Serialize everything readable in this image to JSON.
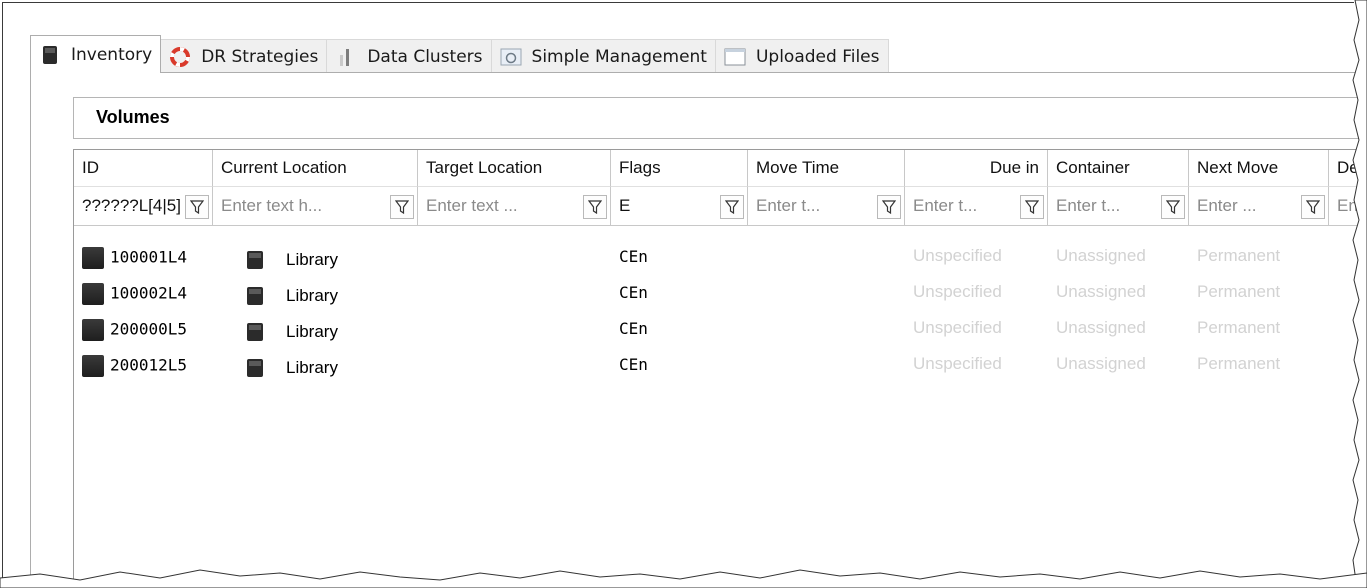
{
  "tabs": [
    {
      "label": "Inventory",
      "icon": "tape-library-icon",
      "active": true
    },
    {
      "label": "DR Strategies",
      "icon": "lifebuoy-icon",
      "active": false
    },
    {
      "label": "Data Clusters",
      "icon": "data-cluster-icon",
      "active": false
    },
    {
      "label": "Simple Management",
      "icon": "simple-management-icon",
      "active": false
    },
    {
      "label": "Uploaded Files",
      "icon": "uploaded-files-icon",
      "active": false
    }
  ],
  "group": {
    "title": "Volumes"
  },
  "columns": [
    {
      "header": "ID",
      "filter_value": "??????L[4|5]",
      "filter_placeholder": ""
    },
    {
      "header": "Current Location",
      "filter_value": "",
      "filter_placeholder": "Enter text h..."
    },
    {
      "header": "Target Location",
      "filter_value": "",
      "filter_placeholder": "Enter text ..."
    },
    {
      "header": "Flags",
      "filter_value": "E",
      "filter_placeholder": ""
    },
    {
      "header": "Move Time",
      "filter_value": "",
      "filter_placeholder": "Enter t..."
    },
    {
      "header": "Due in",
      "filter_value": "",
      "filter_placeholder": "Enter t..."
    },
    {
      "header": "Container",
      "filter_value": "",
      "filter_placeholder": "Enter t..."
    },
    {
      "header": "Next Move",
      "filter_value": "",
      "filter_placeholder": "Enter ..."
    },
    {
      "header": "De",
      "filter_value": "",
      "filter_placeholder": "Ent"
    }
  ],
  "rows": [
    {
      "id": "100001L4",
      "current_location": "Library",
      "flags": "CEn",
      "due_in": "Unspecified",
      "container": "Unassigned",
      "next_move": "Permanent"
    },
    {
      "id": "100002L4",
      "current_location": "Library",
      "flags": "CEn",
      "due_in": "Unspecified",
      "container": "Unassigned",
      "next_move": "Permanent"
    },
    {
      "id": "200000L5",
      "current_location": "Library",
      "flags": "CEn",
      "due_in": "Unspecified",
      "container": "Unassigned",
      "next_move": "Permanent"
    },
    {
      "id": "200012L5",
      "current_location": "Library",
      "flags": "CEn",
      "due_in": "Unspecified",
      "container": "Unassigned",
      "next_move": "Permanent"
    }
  ],
  "colors": {
    "muted_text": "#d2d2d2",
    "border": "#adadad",
    "tab_bg": "#f0f0f0"
  }
}
